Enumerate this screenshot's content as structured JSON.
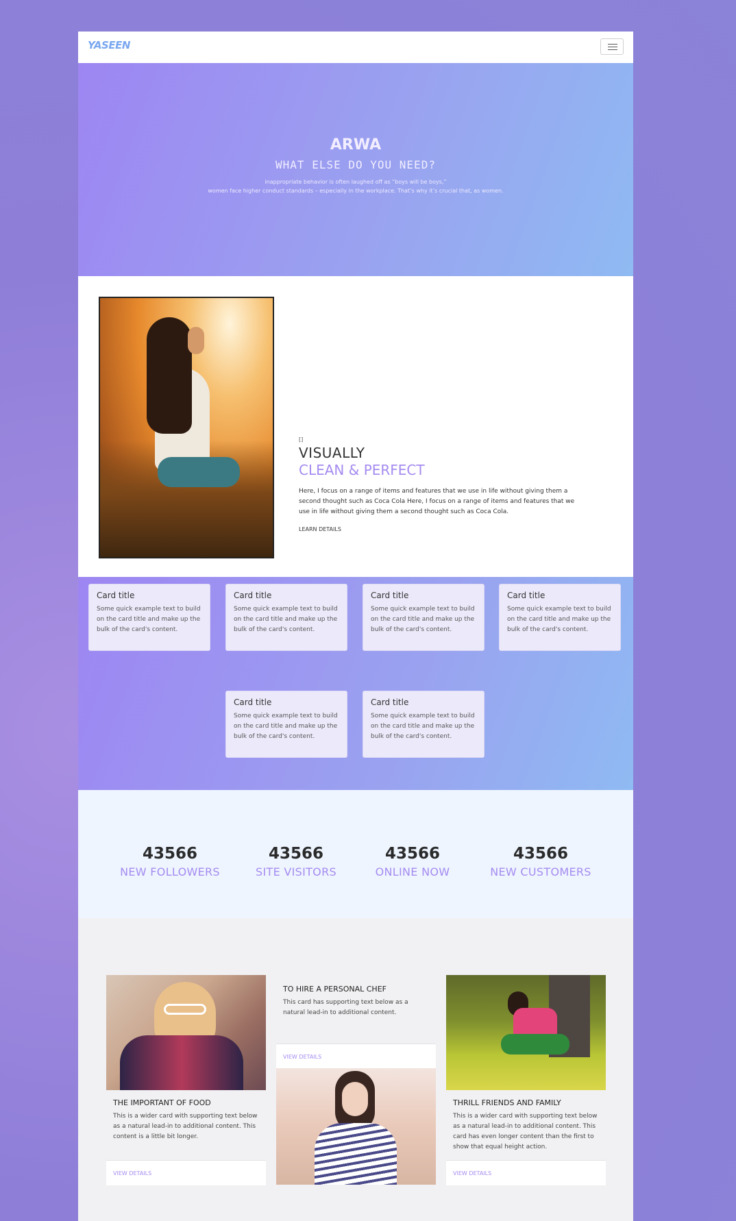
{
  "navbar": {
    "brand": "YASEEN"
  },
  "hero": {
    "title": "ARWA",
    "subtitle": "WHAT ELSE DO YOU NEED?",
    "line1": "inappropriate behavior is often laughed off as “boys will be boys,”",
    "line2": "women face higher conduct standards – especially in the workplace. That’s why it’s crucial that, as women."
  },
  "about": {
    "small": "[]",
    "heading1": "VISUALLY",
    "heading2": "CLEAN & PERFECT",
    "text": "Here, I focus on a range of items and features that we use in life without giving them a second thought such as Coca Cola Here, I focus on a range of items and features that we use in life without giving them a second thought such as Coca Cola.",
    "link": "LEARN DETAILS"
  },
  "cards": [
    {
      "title": "Card title",
      "text": "Some quick example text to build on the card title and make up the bulk of the card's content."
    },
    {
      "title": "Card title",
      "text": "Some quick example text to build on the card title and make up the bulk of the card's content."
    },
    {
      "title": "Card title",
      "text": "Some quick example text to build on the card title and make up the bulk of the card's content."
    },
    {
      "title": "Card title",
      "text": "Some quick example text to build on the card title and make up the bulk of the card's content."
    },
    {
      "title": "Card title",
      "text": "Some quick example text to build on the card title and make up the bulk of the card's content."
    },
    {
      "title": "Card title",
      "text": "Some quick example text to build on the card title and make up the bulk of the card's content."
    }
  ],
  "stats": [
    {
      "number": "43566",
      "label": "NEW FOLLOWERS"
    },
    {
      "number": "43566",
      "label": "SITE VISITORS"
    },
    {
      "number": "43566",
      "label": "ONLINE NOW"
    },
    {
      "number": "43566",
      "label": "NEW CUSTOMERS"
    }
  ],
  "blog": {
    "card1": {
      "title": "THE IMPORTANT OF FOOD",
      "text": "This is a wider card with supporting text below as a natural lead-in to additional content. This content is a little bit longer.",
      "link": "VIEW DETAILS"
    },
    "card2": {
      "title": "TO HIRE A PERSONAL CHEF",
      "text": "This card has supporting text below as a natural lead-in to additional content.",
      "link": "VIEW DETAILS"
    },
    "card3": {
      "title": "THRILL FRIENDS AND FAMILY",
      "text": "This is a wider card with supporting text below as a natural lead-in to additional content. This card has even longer content than the first to show that equal height action.",
      "link": "VIEW DETAILS"
    }
  }
}
